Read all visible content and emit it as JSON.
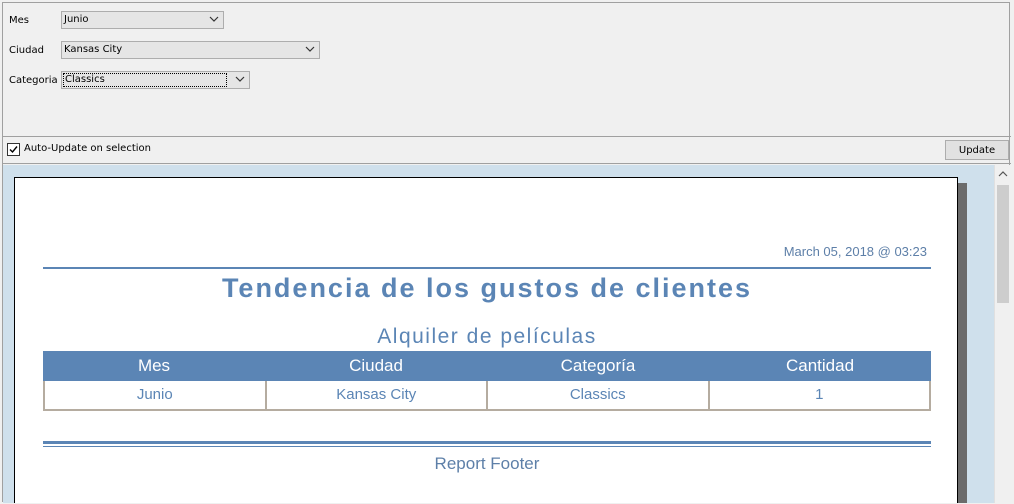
{
  "params": {
    "mes": {
      "label": "Mes",
      "value": "Junio"
    },
    "ciudad": {
      "label": "Ciudad",
      "value": "Kansas City"
    },
    "categoria": {
      "label": "Categoria",
      "value": "Classics"
    }
  },
  "toolbar": {
    "auto_update_label": "Auto-Update on selection",
    "auto_update_checked": true,
    "update_label": "Update"
  },
  "report": {
    "date": "March 05, 2018 @ 03:23",
    "title": "Tendencia de los gustos de clientes",
    "subtitle": "Alquiler de películas",
    "columns": [
      "Mes",
      "Ciudad",
      "Categoría",
      "Cantidad"
    ],
    "rows": [
      [
        "Junio",
        "Kansas City",
        "Classics",
        "1"
      ]
    ],
    "footer": "Report Footer"
  },
  "colors": {
    "accent": "#5b85b5",
    "preview_bg": "#cfe0ec",
    "table_border": "#b5aca0"
  }
}
